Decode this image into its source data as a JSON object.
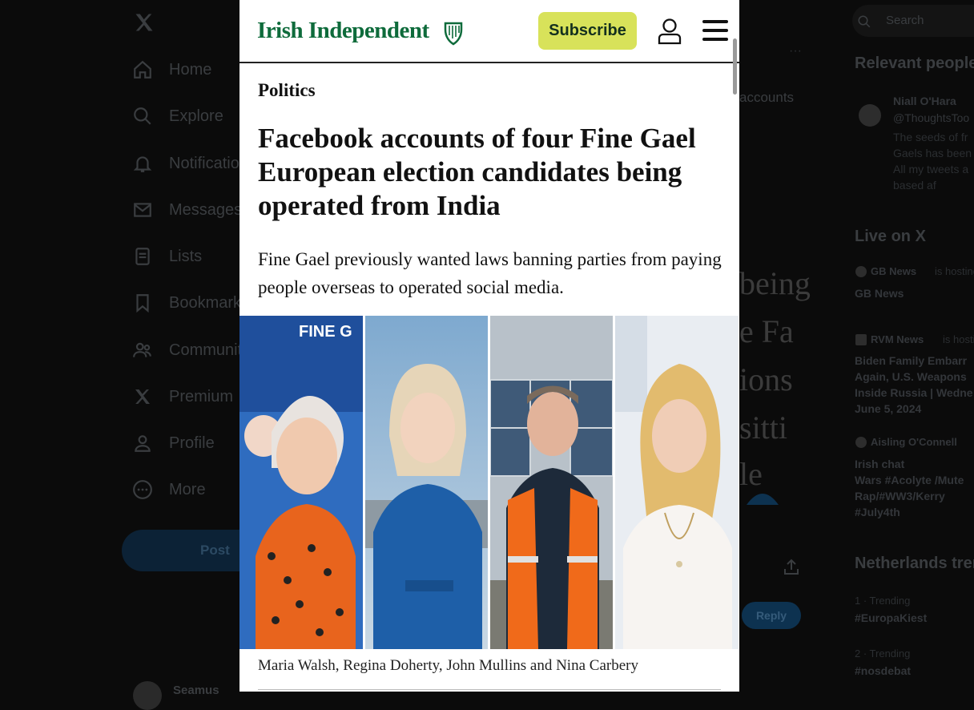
{
  "sidebar": {
    "items": [
      {
        "label": "Home",
        "icon": "home-icon"
      },
      {
        "label": "Explore",
        "icon": "search-icon"
      },
      {
        "label": "Notifications",
        "icon": "bell-icon"
      },
      {
        "label": "Messages",
        "icon": "mail-icon"
      },
      {
        "label": "Lists",
        "icon": "list-icon"
      },
      {
        "label": "Bookmarks",
        "icon": "bookmark-icon"
      },
      {
        "label": "Communities",
        "icon": "people-icon"
      },
      {
        "label": "Premium",
        "icon": "x-icon"
      },
      {
        "label": "Profile",
        "icon": "person-icon"
      },
      {
        "label": "More",
        "icon": "more-icon"
      }
    ],
    "post_label": "Post",
    "account_name": "Seamus"
  },
  "background": {
    "more_dots": "···",
    "accounts_fragment": "accounts",
    "serif_lines": [
      "being",
      "e Fa",
      "ions",
      "sitti",
      "le"
    ],
    "reply_label": "Reply"
  },
  "right": {
    "search_placeholder": "Search",
    "relevant_title": "Relevant people",
    "relevant_name": "Niall O'Hara",
    "relevant_handle": "@ThoughtsToo",
    "relevant_bio": [
      "The seeds of fr",
      "Gaels has been",
      "All my tweets a",
      "based af"
    ],
    "live_title": "Live on X",
    "live": [
      {
        "host": "GB News",
        "meta": "is hosting",
        "title": [
          "GB News"
        ]
      },
      {
        "host": "RVM News",
        "meta": "is hosting",
        "title": [
          "Biden Family Embarr",
          "Again, U.S. Weapons",
          "Inside Russia | Wedne",
          "June 5, 2024"
        ]
      },
      {
        "host": "Aisling O'Connell",
        "meta": "",
        "title": [
          "Irish chat",
          "Wars #Acolyte /Mute",
          "Rap/#WW3/Kerry",
          "#July4th"
        ]
      }
    ],
    "trends_title": "Netherlands trends",
    "trends": [
      {
        "meta": "1 · Trending",
        "tag": "#EuropaKiest"
      },
      {
        "meta": "2 · Trending",
        "tag": "#nosdebat"
      }
    ]
  },
  "article": {
    "brand": "Irish Independent",
    "subscribe_label": "Subscribe",
    "section": "Politics",
    "headline": "Facebook accounts of four Fine Gael European election candidates being operated from India",
    "standfirst": "Fine Gael previously wanted laws banning parties from paying people overseas to operated social media.",
    "caption": "Maria Walsh, Regina Doherty, John Mullins and Nina Carbery",
    "photo_sign_text": "FINE G",
    "colors": {
      "brand_green": "#0e6b3b",
      "subscribe_bg": "#d8e25a"
    }
  }
}
